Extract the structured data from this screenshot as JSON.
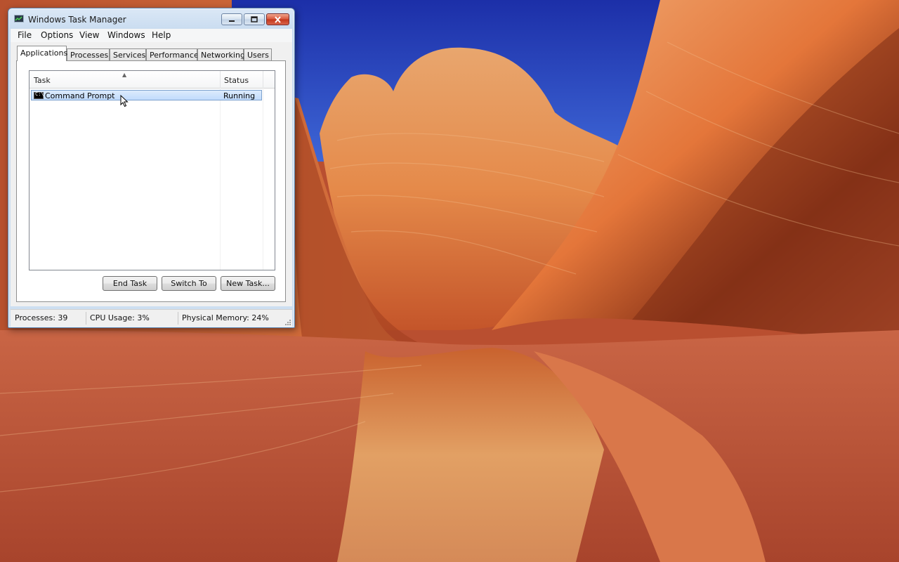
{
  "window": {
    "title": "Windows Task Manager"
  },
  "menu": [
    "File",
    "Options",
    "View",
    "Windows",
    "Help"
  ],
  "tabs": [
    {
      "label": "Applications",
      "active": true
    },
    {
      "label": "Processes",
      "active": false
    },
    {
      "label": "Services",
      "active": false
    },
    {
      "label": "Performance",
      "active": false
    },
    {
      "label": "Networking",
      "active": false
    },
    {
      "label": "Users",
      "active": false
    }
  ],
  "task_list": {
    "columns": [
      "Task",
      "Status"
    ],
    "rows": [
      {
        "task": "Command Prompt",
        "status": "Running",
        "icon": "cmd-icon",
        "selected": true
      }
    ]
  },
  "buttons": {
    "end_task": "End Task",
    "switch_to": "Switch To",
    "new_task": "New Task..."
  },
  "statusbar": {
    "processes": "Processes: 39",
    "cpu": "CPU Usage: 3%",
    "memory": "Physical Memory: 24%"
  },
  "colors": {
    "sky": "#2f45c8",
    "rock": "#e07a3c",
    "selection": "#cfe3fc",
    "close_button": "#c8432a"
  }
}
